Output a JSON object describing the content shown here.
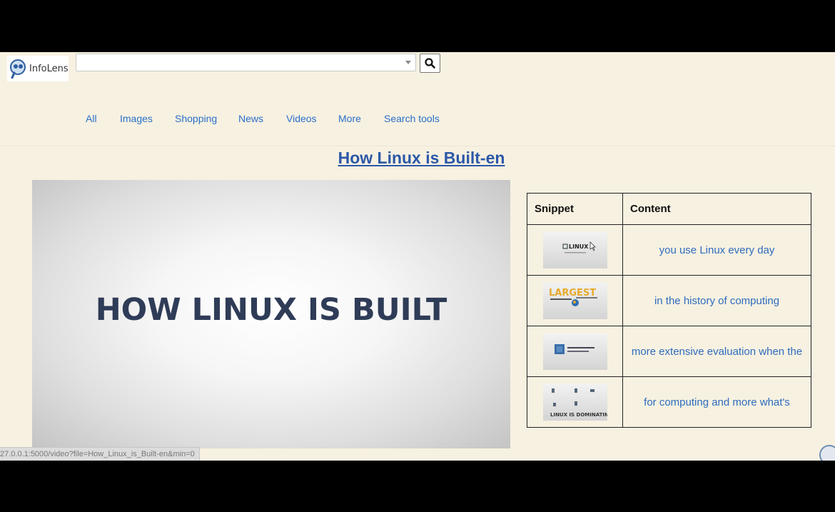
{
  "app": {
    "logo_text": "InfoLens"
  },
  "search": {
    "value": "",
    "placeholder": ""
  },
  "nav": {
    "tabs": [
      "All",
      "Images",
      "Shopping",
      "News",
      "Videos",
      "More",
      "Search tools"
    ]
  },
  "video": {
    "title": "How Linux is Built-en",
    "frame_text": "HOW LINUX IS BUILT"
  },
  "table": {
    "headers": [
      "Snippet",
      "Content"
    ],
    "rows": [
      {
        "thumb_text": "LINUX",
        "content": "you use Linux every day"
      },
      {
        "thumb_text": "LARGEST",
        "content": "in the history of computing"
      },
      {
        "thumb_text": "",
        "content": "more extensive evaluation when the"
      },
      {
        "thumb_text": "LINUX IS DOMINATING",
        "content": "for computing and more what's"
      }
    ]
  },
  "status_bar": {
    "url": "27.0.0.1:5000/video?file=How_Linux_is_Built-en&min=0"
  },
  "colors": {
    "page_bg": "#f7f1e1",
    "link": "#2a6fc9",
    "title": "#2c58a8"
  }
}
